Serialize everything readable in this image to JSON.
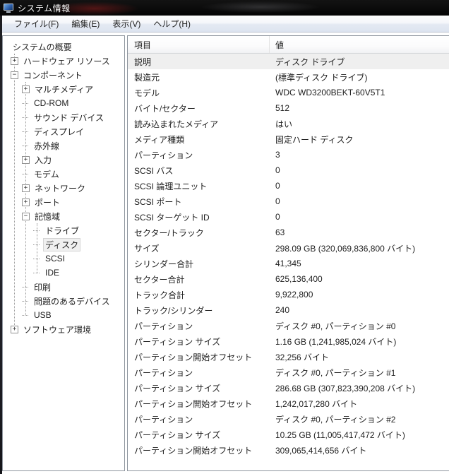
{
  "window": {
    "title": "システム情報",
    "icon": "computer-monitor-icon"
  },
  "menu": {
    "items": [
      {
        "label": "ファイル(F)"
      },
      {
        "label": "編集(E)"
      },
      {
        "label": "表示(V)"
      },
      {
        "label": "ヘルプ(H)"
      }
    ]
  },
  "tree": {
    "items": [
      {
        "label": "システムの概要",
        "level": 0,
        "expander": "root"
      },
      {
        "label": "ハードウェア リソース",
        "level": 0,
        "expander": "plus"
      },
      {
        "label": "コンポーネント",
        "level": 0,
        "expander": "minus"
      },
      {
        "label": "マルチメディア",
        "level": 1,
        "expander": "plus"
      },
      {
        "label": "CD-ROM",
        "level": 1,
        "expander": "none"
      },
      {
        "label": "サウンド デバイス",
        "level": 1,
        "expander": "none"
      },
      {
        "label": "ディスプレイ",
        "level": 1,
        "expander": "none"
      },
      {
        "label": "赤外線",
        "level": 1,
        "expander": "none"
      },
      {
        "label": "入力",
        "level": 1,
        "expander": "plus"
      },
      {
        "label": "モデム",
        "level": 1,
        "expander": "none"
      },
      {
        "label": "ネットワーク",
        "level": 1,
        "expander": "plus"
      },
      {
        "label": "ポート",
        "level": 1,
        "expander": "plus"
      },
      {
        "label": "記憶域",
        "level": 1,
        "expander": "minus"
      },
      {
        "label": "ドライブ",
        "level": 2,
        "expander": "none"
      },
      {
        "label": "ディスク",
        "level": 2,
        "expander": "none",
        "selected": true
      },
      {
        "label": "SCSI",
        "level": 2,
        "expander": "none"
      },
      {
        "label": "IDE",
        "level": 2,
        "expander": "none"
      },
      {
        "label": "印刷",
        "level": 1,
        "expander": "none"
      },
      {
        "label": "問題のあるデバイス",
        "level": 1,
        "expander": "none"
      },
      {
        "label": "USB",
        "level": 1,
        "expander": "none"
      },
      {
        "label": "ソフトウェア環境",
        "level": 0,
        "expander": "plus"
      }
    ]
  },
  "table": {
    "columns": {
      "item": "項目",
      "value": "値"
    },
    "rows": [
      {
        "item": "説明",
        "value": "ディスク ドライブ",
        "selected": true
      },
      {
        "item": "製造元",
        "value": "(標準ディスク ドライブ)"
      },
      {
        "item": "モデル",
        "value": "WDC WD3200BEKT-60V5T1"
      },
      {
        "item": "バイト/セクター",
        "value": "512"
      },
      {
        "item": "読み込まれたメディア",
        "value": "はい"
      },
      {
        "item": "メディア種類",
        "value": "固定ハード ディスク"
      },
      {
        "item": "パーティション",
        "value": "3"
      },
      {
        "item": "SCSI バス",
        "value": "0"
      },
      {
        "item": "SCSI 論理ユニット",
        "value": "0"
      },
      {
        "item": "SCSI ポート",
        "value": "0"
      },
      {
        "item": "SCSI ターゲット ID",
        "value": "0"
      },
      {
        "item": "セクター/トラック",
        "value": "63"
      },
      {
        "item": "サイズ",
        "value": "298.09 GB (320,069,836,800 バイト)"
      },
      {
        "item": "シリンダー合計",
        "value": "41,345"
      },
      {
        "item": "セクター合計",
        "value": "625,136,400"
      },
      {
        "item": "トラック合計",
        "value": "9,922,800"
      },
      {
        "item": "トラック/シリンダー",
        "value": "240"
      },
      {
        "item": "パーティション",
        "value": "ディスク #0, パーティション #0"
      },
      {
        "item": "パーティション サイズ",
        "value": "1.16 GB (1,241,985,024 バイト)"
      },
      {
        "item": "パーティション開始オフセット",
        "value": "32,256 バイト"
      },
      {
        "item": "パーティション",
        "value": "ディスク #0, パーティション #1"
      },
      {
        "item": "パーティション サイズ",
        "value": "286.68 GB (307,823,390,208 バイト)"
      },
      {
        "item": "パーティション開始オフセット",
        "value": "1,242,017,280 バイト"
      },
      {
        "item": "パーティション",
        "value": "ディスク #0, パーティション #2"
      },
      {
        "item": "パーティション サイズ",
        "value": "10.25 GB (11,005,417,472 バイト)"
      },
      {
        "item": "パーティション開始オフセット",
        "value": "309,065,414,656 バイト"
      }
    ]
  },
  "colors": {
    "titlebar_bg": "#0a0a0a",
    "selection_bg": "#efefef",
    "panel_border": "#8e959e",
    "icon_screen_blue": "#2a5ca8"
  }
}
